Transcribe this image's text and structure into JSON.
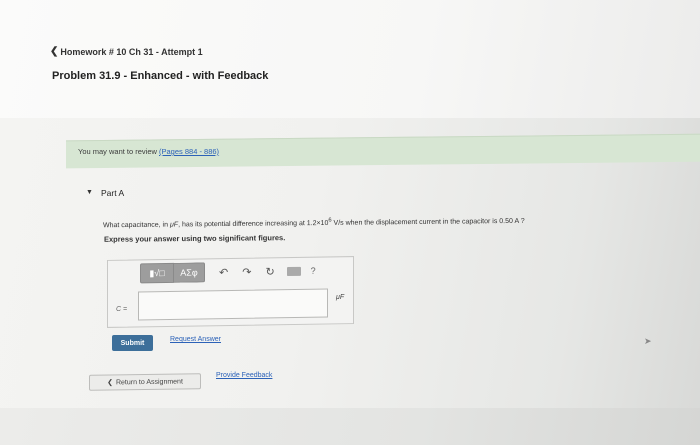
{
  "breadcrumb": {
    "chevron": "❮",
    "text": "Homework # 10 Ch 31 - Attempt 1"
  },
  "problem": {
    "title": "Problem 31.9 - Enhanced - with Feedback"
  },
  "review": {
    "text": "You may want to review ",
    "link": "(Pages 884 - 886)"
  },
  "part": {
    "toggle": "▼",
    "label": "Part A"
  },
  "question": {
    "text_1": "What capacitance, in ",
    "unit_inline": "μF",
    "text_2": ", has its potential difference increasing at 1.2×10",
    "exponent": "6",
    "text_3": " V/s when the displacement current in the capacitor is 0.50 A ?"
  },
  "instruction": "Express your answer using two significant figures.",
  "toolbar": {
    "matrix_label": "▮√□",
    "greek_label": "ΑΣφ",
    "undo": "↶",
    "redo": "↷",
    "reset": "↻",
    "help": "?"
  },
  "answer": {
    "variable_label": "C =",
    "value": "",
    "unit": "μF"
  },
  "actions": {
    "submit_label": "Submit",
    "request_label": "Request Answer",
    "return_chevron": "❮",
    "return_label": "Return to Assignment",
    "feedback_label": "Provide Feedback"
  }
}
